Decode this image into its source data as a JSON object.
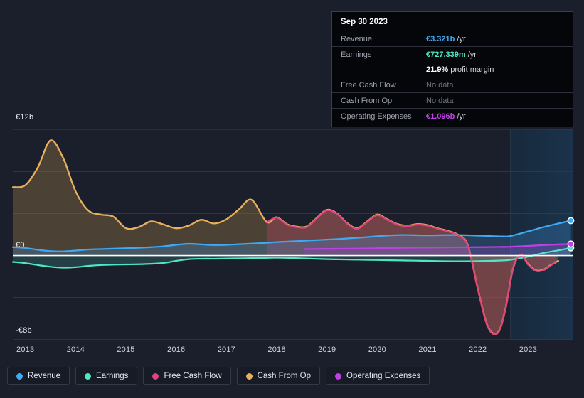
{
  "background_color": "#1a1f2b",
  "tooltip": {
    "date": "Sep 30 2023",
    "rows": [
      {
        "label": "Revenue",
        "value": "€3.321b",
        "suffix": "/yr",
        "color": "#3fa9f5",
        "no_data": false
      },
      {
        "label": "Earnings",
        "value": "€727.339m",
        "suffix": "/yr",
        "color": "#4ee6c4",
        "no_data": false
      },
      {
        "label": "Free Cash Flow",
        "value": "No data",
        "suffix": "",
        "color": "#e0447c",
        "no_data": true
      },
      {
        "label": "Cash From Op",
        "value": "No data",
        "suffix": "",
        "color": "#e8b05c",
        "no_data": true
      },
      {
        "label": "Operating Expenses",
        "value": "€1.096b",
        "suffix": "/yr",
        "color": "#c040e8",
        "no_data": false
      }
    ],
    "sub_row": {
      "value": "21.9%",
      "suffix": "profit margin"
    }
  },
  "legend": {
    "items": [
      {
        "label": "Revenue",
        "color": "#3fa9f5"
      },
      {
        "label": "Earnings",
        "color": "#4ee6c4"
      },
      {
        "label": "Free Cash Flow",
        "color": "#e0447c"
      },
      {
        "label": "Cash From Op",
        "color": "#e8b05c"
      },
      {
        "label": "Operating Expenses",
        "color": "#c040e8"
      }
    ]
  },
  "chart_data": {
    "type": "area",
    "title": "",
    "xlabel": "",
    "ylabel": "",
    "currency": "EUR",
    "grid": true,
    "legend_position": "bottom",
    "ylim": [
      -8,
      12
    ],
    "y_ticks": [
      {
        "value": 12,
        "label": "€12b"
      },
      {
        "value": 0,
        "label": "€0"
      },
      {
        "value": -8,
        "label": "-€8b"
      }
    ],
    "y_gridlines": [
      12,
      8,
      4,
      0,
      -4
    ],
    "x_ticks": [
      "2013",
      "2014",
      "2015",
      "2016",
      "2017",
      "2018",
      "2019",
      "2020",
      "2021",
      "2022",
      "2023"
    ],
    "xlim": [
      2012.75,
      2023.9
    ],
    "forecast_region_start": 2022.65,
    "series": [
      {
        "name": "Revenue",
        "color": "#3fa9f5",
        "fill": "rgba(63,140,210,0.30)",
        "end_marker": true,
        "x": [
          2012.75,
          2013.0,
          2013.25,
          2013.5,
          2013.75,
          2014.0,
          2014.25,
          2014.5,
          2014.75,
          2015.0,
          2015.25,
          2015.5,
          2015.75,
          2016.0,
          2016.25,
          2016.5,
          2016.75,
          2017.0,
          2017.25,
          2017.5,
          2017.75,
          2018.0,
          2018.25,
          2018.5,
          2018.75,
          2019.0,
          2019.25,
          2019.5,
          2019.75,
          2020.0,
          2020.25,
          2020.5,
          2020.75,
          2021.0,
          2021.25,
          2021.5,
          2021.75,
          2022.0,
          2022.25,
          2022.5,
          2022.65,
          2023.0,
          2023.3,
          2023.6,
          2023.85
        ],
        "y": [
          0.8,
          0.72,
          0.55,
          0.42,
          0.4,
          0.48,
          0.58,
          0.62,
          0.66,
          0.7,
          0.74,
          0.8,
          0.88,
          1.02,
          1.12,
          1.06,
          1.0,
          1.02,
          1.08,
          1.14,
          1.2,
          1.28,
          1.34,
          1.4,
          1.46,
          1.52,
          1.58,
          1.66,
          1.74,
          1.84,
          1.92,
          1.96,
          1.94,
          1.92,
          1.94,
          1.96,
          1.94,
          1.9,
          1.86,
          1.82,
          1.86,
          2.3,
          2.7,
          3.05,
          3.32
        ]
      },
      {
        "name": "Earnings",
        "color": "#4ee6c4",
        "fill": "rgba(78,200,180,0.20)",
        "end_marker": true,
        "x": [
          2012.75,
          2013.0,
          2013.25,
          2013.5,
          2013.75,
          2014.0,
          2014.25,
          2014.5,
          2014.75,
          2015.0,
          2015.25,
          2015.5,
          2015.75,
          2016.0,
          2016.25,
          2016.5,
          2016.75,
          2017.0,
          2017.25,
          2017.5,
          2017.75,
          2018.0,
          2018.25,
          2018.5,
          2018.75,
          2019.0,
          2019.25,
          2019.5,
          2019.75,
          2020.0,
          2020.25,
          2020.5,
          2020.75,
          2021.0,
          2021.25,
          2021.5,
          2021.75,
          2022.0,
          2022.25,
          2022.5,
          2022.65,
          2023.0,
          2023.3,
          2023.6,
          2023.85
        ],
        "y": [
          -0.6,
          -0.72,
          -0.9,
          -1.06,
          -1.14,
          -1.1,
          -0.98,
          -0.9,
          -0.86,
          -0.84,
          -0.82,
          -0.78,
          -0.7,
          -0.5,
          -0.34,
          -0.3,
          -0.3,
          -0.28,
          -0.26,
          -0.24,
          -0.22,
          -0.2,
          -0.22,
          -0.26,
          -0.3,
          -0.34,
          -0.36,
          -0.38,
          -0.4,
          -0.42,
          -0.44,
          -0.46,
          -0.48,
          -0.5,
          -0.52,
          -0.54,
          -0.54,
          -0.52,
          -0.5,
          -0.46,
          -0.4,
          -0.1,
          0.24,
          0.5,
          0.73
        ]
      },
      {
        "name": "Free Cash Flow",
        "color": "#e0447c",
        "fill": "rgba(170,70,95,0.42)",
        "start_x": 2017.8,
        "end_x": 2023.55,
        "end_marker": false,
        "x": [
          2017.8,
          2018.0,
          2018.2,
          2018.4,
          2018.6,
          2018.8,
          2019.0,
          2019.2,
          2019.4,
          2019.6,
          2019.8,
          2020.0,
          2020.2,
          2020.4,
          2020.6,
          2020.8,
          2021.0,
          2021.2,
          2021.4,
          2021.6,
          2021.8,
          2022.0,
          2022.2,
          2022.4,
          2022.55,
          2022.7,
          2022.85,
          2023.0,
          2023.15,
          2023.3,
          2023.45,
          2023.55
        ],
        "y": [
          3.15,
          3.6,
          2.95,
          2.7,
          2.72,
          3.55,
          4.3,
          3.95,
          3.05,
          2.55,
          3.2,
          3.85,
          3.4,
          2.95,
          2.8,
          2.95,
          2.85,
          2.55,
          2.3,
          1.95,
          0.95,
          -3.2,
          -6.8,
          -7.35,
          -5.1,
          -1.3,
          0.05,
          -0.85,
          -1.45,
          -1.4,
          -0.95,
          -0.55
        ]
      },
      {
        "name": "Cash From Op",
        "color": "#e8b05c",
        "fill": "rgba(150,120,70,0.40)",
        "end_marker": false,
        "x": [
          2012.75,
          2013.0,
          2013.25,
          2013.5,
          2013.75,
          2014.0,
          2014.25,
          2014.5,
          2014.75,
          2015.0,
          2015.25,
          2015.5,
          2015.75,
          2016.0,
          2016.25,
          2016.5,
          2016.75,
          2017.0,
          2017.25,
          2017.5,
          2017.8,
          2018.0,
          2018.2,
          2018.4,
          2018.6,
          2018.8,
          2019.0,
          2019.2,
          2019.4,
          2019.6,
          2019.8,
          2020.0,
          2020.2,
          2020.4,
          2020.6,
          2020.8,
          2021.0,
          2021.2,
          2021.4,
          2021.6,
          2021.8,
          2022.0,
          2022.2,
          2022.4,
          2022.55,
          2022.7,
          2022.85,
          2023.0,
          2023.15,
          2023.3,
          2023.45,
          2023.6
        ],
        "y": [
          6.5,
          6.7,
          8.4,
          10.95,
          9.3,
          6.1,
          4.3,
          3.9,
          3.7,
          2.6,
          2.7,
          3.25,
          2.95,
          2.6,
          2.85,
          3.4,
          3.05,
          3.45,
          4.4,
          5.3,
          3.2,
          3.65,
          3.0,
          2.75,
          2.78,
          3.6,
          4.35,
          4.0,
          3.1,
          2.6,
          3.25,
          3.9,
          3.45,
          3.0,
          2.85,
          3.0,
          2.9,
          2.6,
          2.35,
          2.0,
          1.0,
          -3.15,
          -6.75,
          -7.3,
          -5.05,
          -1.25,
          0.1,
          -0.8,
          -1.4,
          -1.35,
          -0.9,
          -0.5
        ]
      },
      {
        "name": "Operating Expenses",
        "color": "#c040e8",
        "fill": "rgba(150,70,190,0.30)",
        "start_x": 2018.55,
        "end_marker": true,
        "x": [
          2018.55,
          2019.0,
          2019.5,
          2020.0,
          2020.5,
          2021.0,
          2021.5,
          2022.0,
          2022.4,
          2022.65,
          2023.0,
          2023.3,
          2023.6,
          2023.85
        ],
        "y": [
          0.62,
          0.64,
          0.66,
          0.7,
          0.74,
          0.76,
          0.78,
          0.8,
          0.82,
          0.84,
          0.92,
          1.0,
          1.06,
          1.1
        ]
      }
    ]
  }
}
